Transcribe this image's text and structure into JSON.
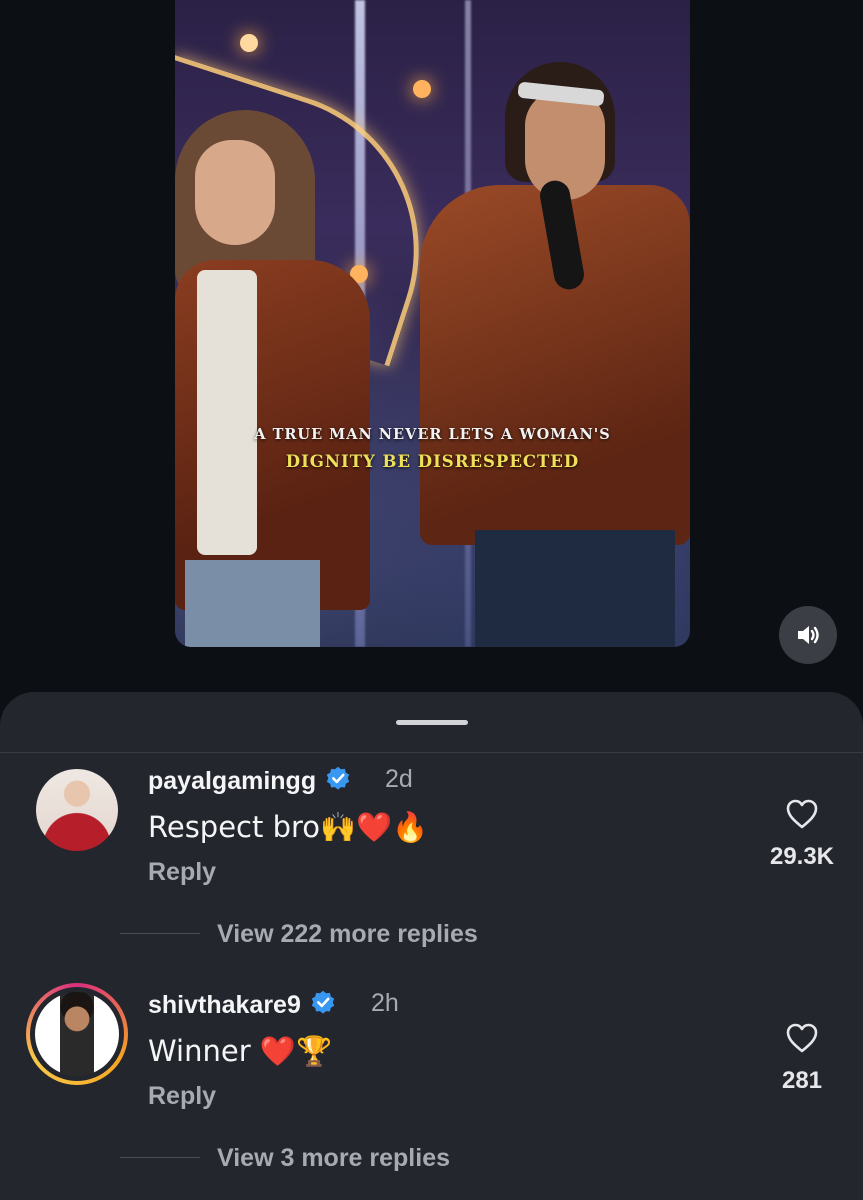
{
  "video": {
    "caption_line1": "A TRUE MAN NEVER LETS A WOMAN'S",
    "caption_line2": "DIGNITY BE DISRESPECTED",
    "sound_icon": "speaker-icon"
  },
  "comments": [
    {
      "username": "payalgamingg",
      "verified": true,
      "time": "2d",
      "text": "Respect bro🙌❤️🔥",
      "reply_label": "Reply",
      "likes": "29.3K",
      "view_replies": "View 222 more replies"
    },
    {
      "username": "shivthakare9",
      "verified": true,
      "time": "2h",
      "text": "Winner ❤️🏆",
      "reply_label": "Reply",
      "likes": "281",
      "view_replies": "View 3 more replies"
    }
  ],
  "colors": {
    "verified_blue": "#3897f0",
    "background": "#0c0f14",
    "sheet": "#24262d"
  }
}
